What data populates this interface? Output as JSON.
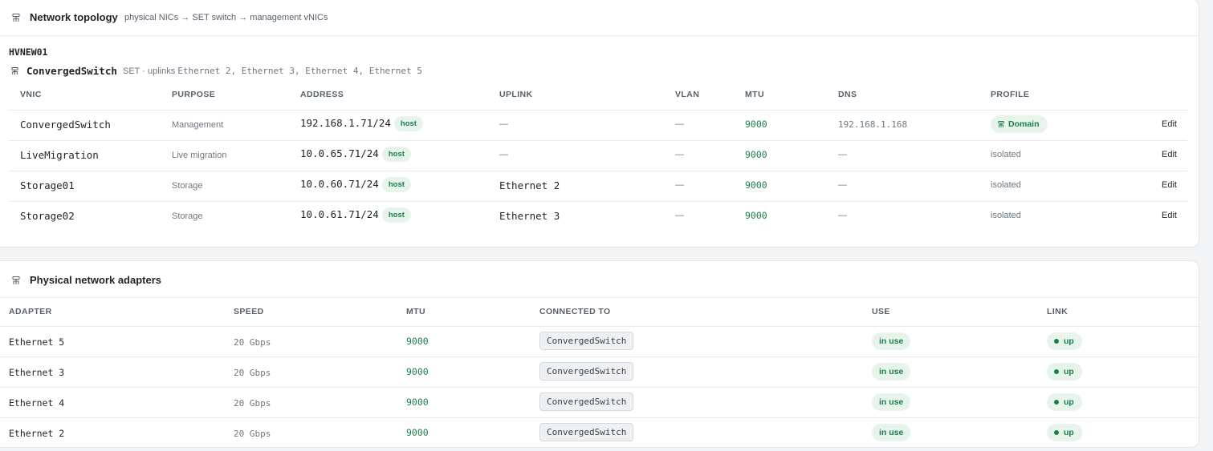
{
  "topology": {
    "title": "Network topology",
    "subtitle": "physical NICs → SET switch → management vNICs",
    "host": "HVNEW01",
    "switch": {
      "name": "ConvergedSwitch",
      "type_label": "SET · uplinks",
      "uplinks": "Ethernet 2, Ethernet 3, Ethernet 4, Ethernet 5"
    },
    "columns": {
      "vnic": "VNIC",
      "purpose": "PURPOSE",
      "address": "ADDRESS",
      "uplink": "UPLINK",
      "vlan": "VLAN",
      "mtu": "MTU",
      "dns": "DNS",
      "profile": "PROFILE"
    },
    "rows": [
      {
        "vnic": "ConvergedSwitch",
        "purpose": "Management",
        "address": "192.168.1.71/24",
        "badge": "host",
        "uplink": "—",
        "vlan": "—",
        "mtu": "9000",
        "dns": "192.168.1.168",
        "profile": "Domain",
        "edit": "Edit"
      },
      {
        "vnic": "LiveMigration",
        "purpose": "Live migration",
        "address": "10.0.65.71/24",
        "badge": "host",
        "uplink": "—",
        "vlan": "—",
        "mtu": "9000",
        "dns": "—",
        "profile": "isolated",
        "edit": "Edit"
      },
      {
        "vnic": "Storage01",
        "purpose": "Storage",
        "address": "10.0.60.71/24",
        "badge": "host",
        "uplink": "Ethernet 2",
        "vlan": "—",
        "mtu": "9000",
        "dns": "—",
        "profile": "isolated",
        "edit": "Edit"
      },
      {
        "vnic": "Storage02",
        "purpose": "Storage",
        "address": "10.0.61.71/24",
        "badge": "host",
        "uplink": "Ethernet 3",
        "vlan": "—",
        "mtu": "9000",
        "dns": "—",
        "profile": "isolated",
        "edit": "Edit"
      }
    ]
  },
  "adapters": {
    "title": "Physical network adapters",
    "columns": {
      "adapter": "ADAPTER",
      "speed": "SPEED",
      "mtu": "MTU",
      "connected": "CONNECTED TO",
      "use": "USE",
      "link": "LINK"
    },
    "rows": [
      {
        "adapter": "Ethernet 5",
        "speed": "20 Gbps",
        "mtu": "9000",
        "connected": "ConvergedSwitch",
        "use": "in use",
        "link": "up"
      },
      {
        "adapter": "Ethernet 3",
        "speed": "20 Gbps",
        "mtu": "9000",
        "connected": "ConvergedSwitch",
        "use": "in use",
        "link": "up"
      },
      {
        "adapter": "Ethernet 4",
        "speed": "20 Gbps",
        "mtu": "9000",
        "connected": "ConvergedSwitch",
        "use": "in use",
        "link": "up"
      },
      {
        "adapter": "Ethernet 2",
        "speed": "20 Gbps",
        "mtu": "9000",
        "connected": "ConvergedSwitch",
        "use": "in use",
        "link": "up"
      }
    ]
  },
  "icons": {
    "section": "network-icon",
    "switch": "network-icon",
    "profile": "network-icon",
    "link_status": "status-dot-icon"
  },
  "colors": {
    "accent_green": "#1a7f4b",
    "pill_green_bg": "#e7f4ec",
    "muted_text": "#6e7781"
  }
}
